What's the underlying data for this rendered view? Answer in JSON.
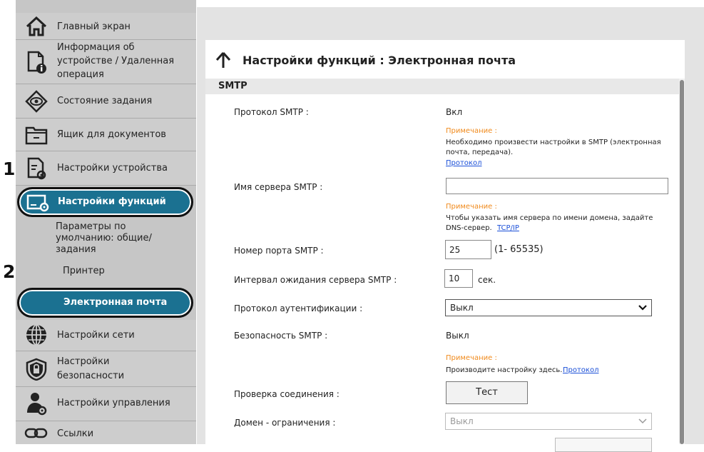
{
  "sidebar": {
    "items": [
      {
        "label": "Главный экран",
        "icon": "home-icon"
      },
      {
        "label": "Информация об устройстве / Удаленная операция",
        "lines": [
          "Информация об",
          "устройстве / Удаленная",
          "операция"
        ],
        "icon": "device-info-icon"
      },
      {
        "label": "Состояние задания",
        "icon": "eye-icon"
      },
      {
        "label": "Ящик для документов",
        "icon": "folder-icon"
      },
      {
        "label": "Настройки устройства",
        "icon": "device-settings-icon"
      },
      {
        "label": "Настройки функций",
        "icon": "function-settings-icon"
      },
      {
        "label": "Настройки сети",
        "icon": "globe-icon"
      },
      {
        "label": "Настройки безопасности",
        "lines": [
          "Настройки",
          "безопасности"
        ],
        "icon": "shield-icon"
      },
      {
        "label": "Настройки управления",
        "icon": "admin-icon"
      },
      {
        "label": "Ссылки",
        "icon": "link-icon"
      }
    ],
    "sub_items": [
      {
        "label": "Параметры по умолчанию: общие/ задания",
        "lines": [
          "Параметры по",
          "умолчанию: общие/",
          "задания"
        ]
      },
      {
        "label": "Принтер"
      },
      {
        "label": "Электронная почта"
      }
    ],
    "steps": [
      "1",
      "2"
    ]
  },
  "page": {
    "title": "Настройки функций : Электронная почта",
    "back_icon": "up-arrow-icon",
    "section": "SMTP"
  },
  "form": {
    "smtp_protocol": {
      "label": "Протокол SMTP :",
      "value": "Вкл"
    },
    "note1": {
      "head": "Примечание :",
      "lines": [
        "Необходимо произвести настройки в SMTP (электронная",
        "почта, передача)."
      ],
      "link": "Протокол"
    },
    "smtp_server": {
      "label": "Имя сервера SMTP :",
      "value": ""
    },
    "note2": {
      "head": "Примечание :",
      "lines": [
        "Чтобы указать имя сервера по имени домена, задайте",
        "DNS-сервер."
      ],
      "link": "TCP/IP"
    },
    "smtp_port": {
      "label": "Номер порта SMTP :",
      "value": "25",
      "range": "(1- 65535)"
    },
    "smtp_timeout": {
      "label": "Интервал ожидания сервера SMTP :",
      "value": "10",
      "unit": "сек."
    },
    "auth_protocol": {
      "label": "Протокол аутентификации :",
      "value": "Выкл"
    },
    "smtp_security": {
      "label": "Безопасность SMTP :",
      "value": "Выкл"
    },
    "note3": {
      "head": "Примечание :",
      "text": "Производите настройку здесь.",
      "link": "Протокол"
    },
    "connection_check": {
      "label": "Проверка соединения :",
      "button": "Тест"
    },
    "domain_restriction": {
      "label": "Домен - ограничения :",
      "value": "Выкл"
    }
  },
  "colors": {
    "accent": "#1b7191",
    "note": "#f08a1c",
    "link": "#1a4fd8"
  }
}
